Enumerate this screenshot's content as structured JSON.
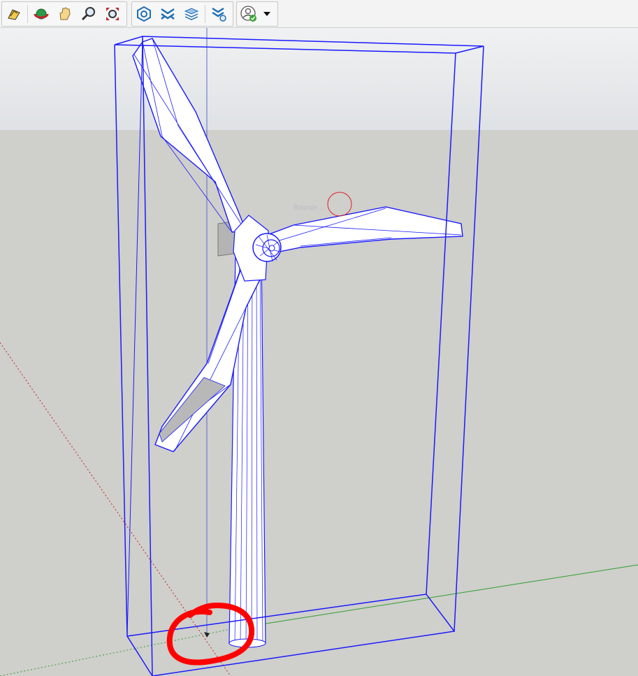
{
  "toolbar": {
    "groups": [
      {
        "tools": [
          "select-tool-icon",
          "orbit-tool-icon",
          "pan-tool-icon",
          "zoom-tool-icon",
          "zoom-extents-icon"
        ]
      },
      {
        "tools": [
          "extension-warehouse-icon",
          "sandbox-icon",
          "layers-icon",
          "model-settings-icon"
        ]
      },
      {
        "tools": [
          "account-icon",
          "account-dropdown-icon"
        ]
      }
    ]
  },
  "viewport": {
    "hint_text": "Bounce ...",
    "colors": {
      "selection": "#1a1aff",
      "x_axis": "#cc2222",
      "y_axis": "#2e9e2e",
      "annotation": "#ff0000",
      "sky": "#e7e9eb",
      "ground": "#cfcfcb"
    }
  }
}
